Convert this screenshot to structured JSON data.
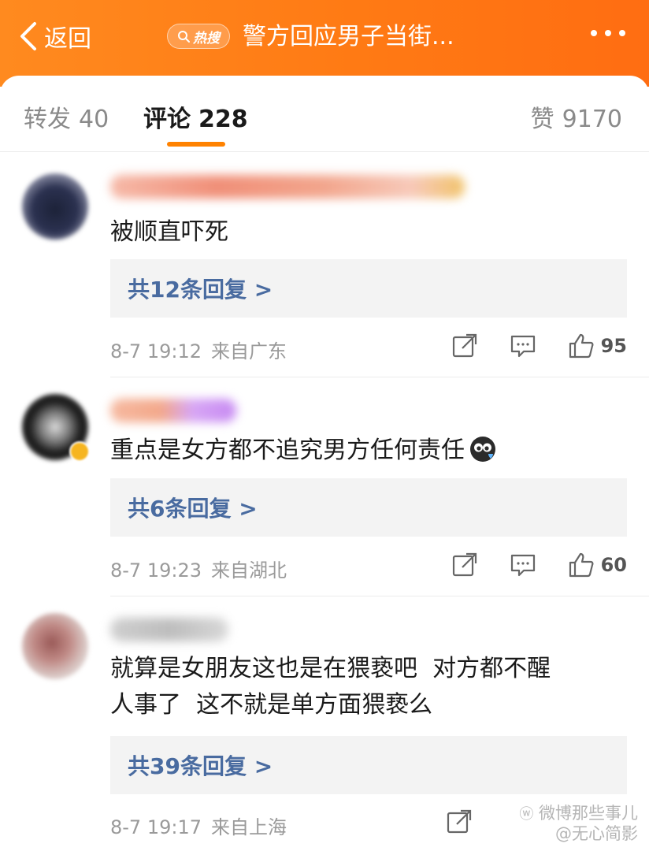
{
  "header": {
    "back_label": "返回",
    "hot_badge": "热搜",
    "title": "警方回应男子当街..."
  },
  "tabs": [
    {
      "label": "转发",
      "count": "40"
    },
    {
      "label": "评论",
      "count": "228"
    },
    {
      "label": "赞",
      "count": "9170"
    }
  ],
  "comments": [
    {
      "text": "被顺直吓死",
      "replies": "共12条回复 >",
      "date": "8-7 19:12",
      "location": "来自广东",
      "likes": "95"
    },
    {
      "text": "重点是女方都不追究男方任何责任",
      "replies": "共6条回复 >",
      "date": "8-7 19:23",
      "location": "来自湖北",
      "likes": "60"
    },
    {
      "text_line1": "就算是女朋友这也是在猥亵吧  对方都不醒",
      "text_line2": "人事了  这不就是单方面猥亵么",
      "replies": "共39条回复 >",
      "date": "8-7 19:17",
      "location": "来自上海"
    }
  ],
  "watermark": {
    "line1": "微博那些事儿",
    "line2": "@无心简影"
  },
  "colors": {
    "header_orange": "#ff7a14",
    "accent_underline": "#ff8200",
    "reply_link_blue": "#496ba0"
  }
}
